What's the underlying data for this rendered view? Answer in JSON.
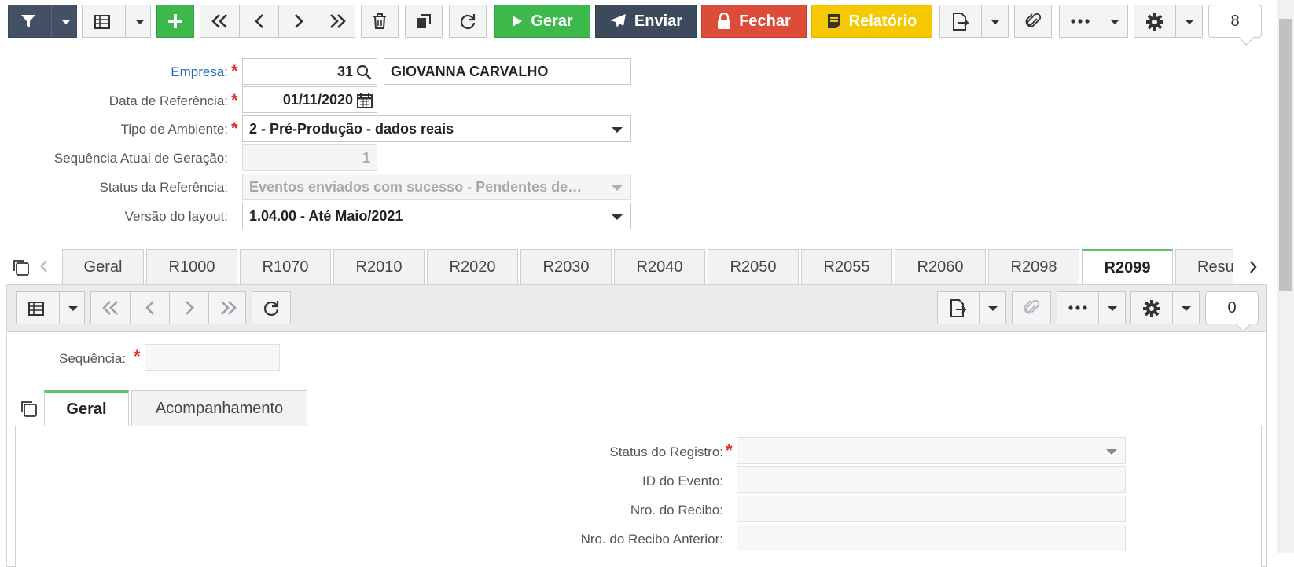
{
  "toolbar": {
    "gerar_label": "Gerar",
    "enviar_label": "Enviar",
    "fechar_label": "Fechar",
    "relatorio_label": "Relatório",
    "record_count": "8",
    "colors": {
      "green": "#3cb94a",
      "navy": "#3d4a5c",
      "red": "#dd4b39",
      "yellow": "#f5c800",
      "dark": "#445063"
    }
  },
  "form": {
    "empresa": {
      "label": "Empresa:",
      "code": "31",
      "name": "GIOVANNA CARVALHO"
    },
    "data_referencia": {
      "label": "Data de Referência:",
      "value": "01/11/2020"
    },
    "tipo_ambiente": {
      "label": "Tipo de Ambiente:",
      "value": "2 - Pré-Produção - dados reais"
    },
    "sequencia_atual": {
      "label": "Sequência Atual de Geração:",
      "value": "1"
    },
    "status_referencia": {
      "label": "Status da Referência:",
      "value": "Eventos enviados com sucesso - Pendentes de…"
    },
    "versao_layout": {
      "label": "Versão do layout:",
      "value": "1.04.00 - Até Maio/2021"
    }
  },
  "tabs": [
    "Geral",
    "R1000",
    "R1070",
    "R2010",
    "R2020",
    "R2030",
    "R2040",
    "R2050",
    "R2055",
    "R2060",
    "R2098",
    "R2099",
    "Resu"
  ],
  "active_tab": "R2099",
  "detail": {
    "record_count": "0",
    "sequencia_label": "Sequência:",
    "sequencia_value": "",
    "subtabs": [
      "Geral",
      "Acompanhamento"
    ],
    "active_subtab": "Geral",
    "fields": {
      "status_registro": "Status do Registro:",
      "id_evento": "ID do Evento:",
      "nro_recibo": "Nro. do Recibo:",
      "nro_recibo_anterior": "Nro. do Recibo Anterior:"
    }
  },
  "accent": {
    "required": "#d9302c",
    "link": "#2a6ebb",
    "active_tab": "#5cc56a"
  }
}
